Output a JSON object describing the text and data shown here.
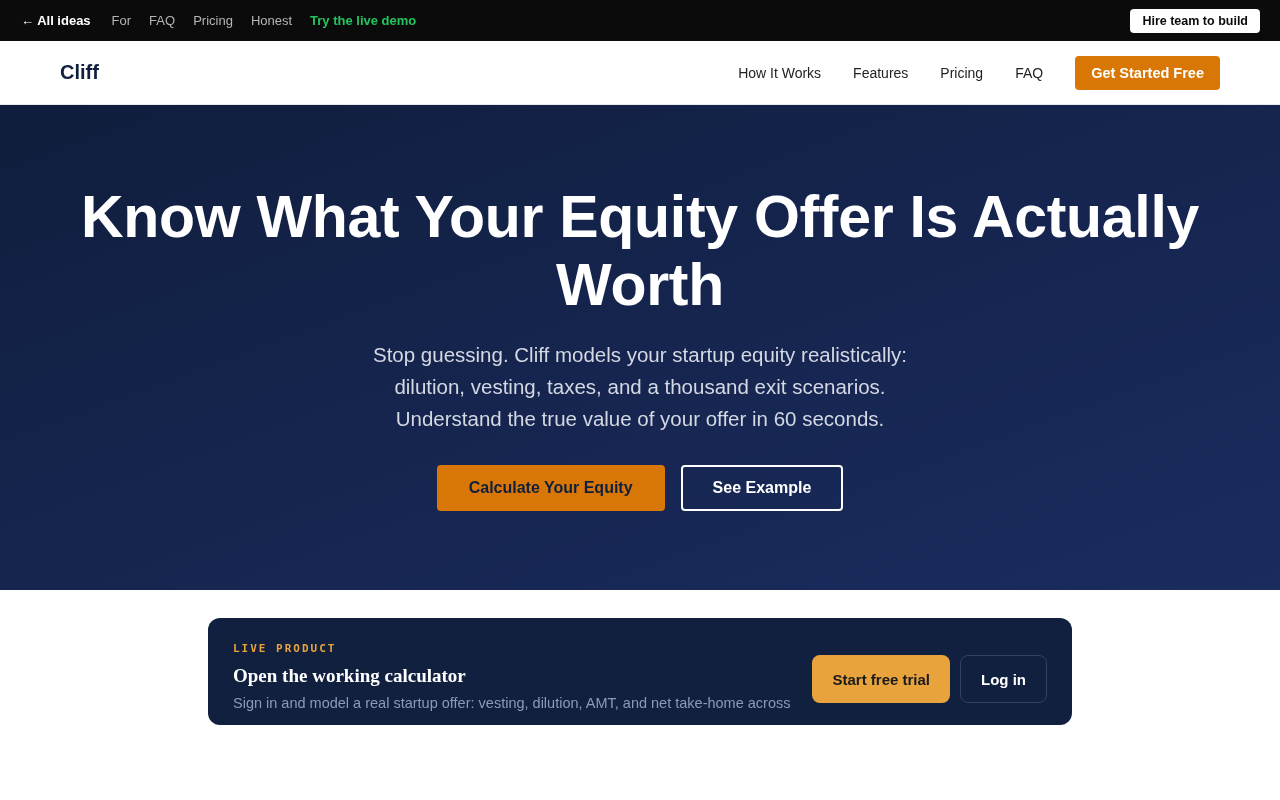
{
  "top_bar": {
    "back_link": "← All ideas",
    "links": [
      {
        "label": "For",
        "kind": "plain"
      },
      {
        "label": "FAQ",
        "kind": "plain"
      },
      {
        "label": "Pricing",
        "kind": "plain"
      },
      {
        "label": "Honest",
        "kind": "plain"
      },
      {
        "label": "Try the live demo",
        "kind": "highlight"
      }
    ],
    "cta": "Hire team to build"
  },
  "nav": {
    "brand": "Cliff",
    "links": [
      "How It Works",
      "Features",
      "Pricing",
      "FAQ"
    ],
    "cta": "Get Started Free"
  },
  "hero": {
    "title": "Know What Your Equity Offer Is Actually Worth",
    "subtitle": "Stop guessing. Cliff models your startup equity realistically: dilution, vesting, taxes, and a thousand exit scenarios. Understand the true value of your offer in 60 seconds.",
    "buttons": [
      {
        "label": "Calculate Your Equity",
        "kind": "primary"
      },
      {
        "label": "See Example",
        "kind": "outline"
      }
    ]
  },
  "product_card": {
    "eyebrow": "LIVE PRODUCT",
    "title": "Open the working calculator",
    "description": "Sign in and model a real startup offer: vesting, dilution, AMT, and net take-home across",
    "buttons": [
      {
        "label": "Start free trial",
        "kind": "primary"
      },
      {
        "label": "Log in",
        "kind": "secondary"
      }
    ]
  }
}
